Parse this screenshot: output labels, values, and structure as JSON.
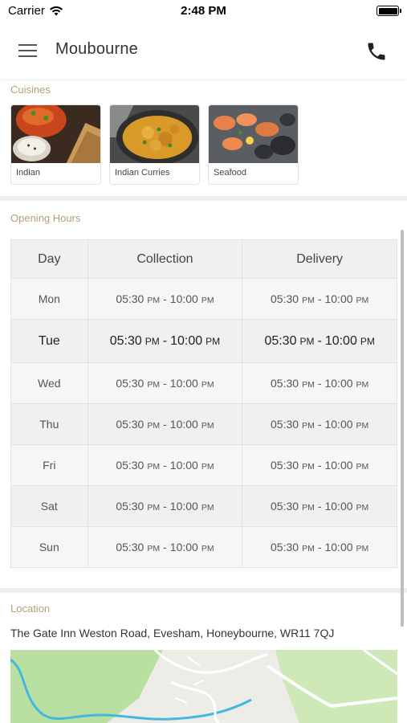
{
  "status_bar": {
    "carrier": "Carrier",
    "time": "2:48 PM",
    "wifi_icon": "wifi-icon",
    "battery_icon": "battery-icon"
  },
  "header": {
    "title": "Moubourne",
    "menu_icon": "hamburger-menu-icon",
    "phone_icon": "phone-icon"
  },
  "cuisines": {
    "label": "Cuisines",
    "items": [
      {
        "name": "Indian"
      },
      {
        "name": "Indian Curries"
      },
      {
        "name": "Seafood"
      }
    ]
  },
  "opening_hours": {
    "label": "Opening Hours",
    "columns": [
      "Day",
      "Collection",
      "Delivery"
    ],
    "ampm": {
      "pm": "PM"
    },
    "rows": [
      {
        "day": "Mon",
        "collection_from": "05:30",
        "collection_to": "10:00",
        "delivery_from": "05:30",
        "delivery_to": "10:00"
      },
      {
        "day": "Tue",
        "collection_from": "05:30",
        "collection_to": "10:00",
        "delivery_from": "05:30",
        "delivery_to": "10:00"
      },
      {
        "day": "Wed",
        "collection_from": "05:30",
        "collection_to": "10:00",
        "delivery_from": "05:30",
        "delivery_to": "10:00"
      },
      {
        "day": "Thu",
        "collection_from": "05:30",
        "collection_to": "10:00",
        "delivery_from": "05:30",
        "delivery_to": "10:00"
      },
      {
        "day": "Fri",
        "collection_from": "05:30",
        "collection_to": "10:00",
        "delivery_from": "05:30",
        "delivery_to": "10:00"
      },
      {
        "day": "Sat",
        "collection_from": "05:30",
        "collection_to": "10:00",
        "delivery_from": "05:30",
        "delivery_to": "10:00"
      },
      {
        "day": "Sun",
        "collection_from": "05:30",
        "collection_to": "10:00",
        "delivery_from": "05:30",
        "delivery_to": "10:00"
      }
    ],
    "highlighted_day": "Tue"
  },
  "location": {
    "label": "Location",
    "address": "The Gate Inn Weston Road, Evesham, Honeybourne, WR11 7QJ"
  },
  "colors": {
    "section_label": "#b3a07a",
    "map_green": "#b9e0a0",
    "map_water": "#42b8e0"
  }
}
